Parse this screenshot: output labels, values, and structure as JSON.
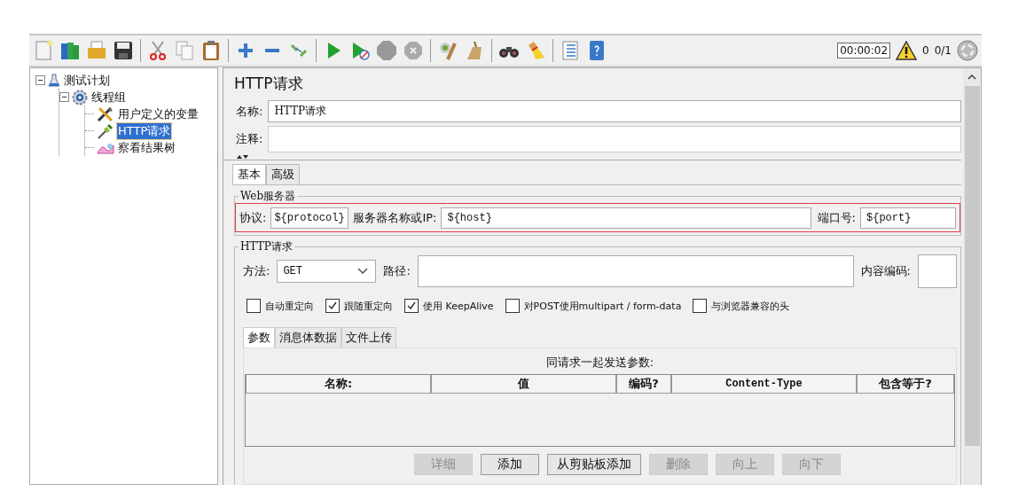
{
  "toolbar": {
    "timer": "00:00:02",
    "warnings": "0",
    "threads": "0/1"
  },
  "tree": [
    {
      "label": "测试计划",
      "kind": "flask",
      "expanded": true,
      "selected": false,
      "children": [
        {
          "label": "线程组",
          "kind": "gear",
          "expanded": true,
          "selected": false,
          "children": [
            {
              "label": "用户定义的变量",
              "kind": "tools",
              "selected": false
            },
            {
              "label": "HTTP请求",
              "kind": "pipette",
              "selected": true
            },
            {
              "label": "察看结果树",
              "kind": "chart",
              "selected": false
            }
          ]
        }
      ]
    }
  ],
  "panel": {
    "title": "HTTP请求",
    "name_label": "名称:",
    "name_value": "HTTP请求",
    "comment_label": "注释:"
  },
  "tabs": [
    {
      "label": "基本",
      "selected": true
    },
    {
      "label": "高级",
      "selected": false
    }
  ],
  "web_server": {
    "legend": "Web服务器",
    "highlighted": true,
    "protocol_label": "协议:",
    "protocol": "${protocol}",
    "host_label": "服务器名称或IP:",
    "host": "${host}",
    "port_label": "端口号:",
    "port": "${port}"
  },
  "http_request": {
    "legend": "HTTP请求",
    "method_label": "方法:",
    "method": "GET",
    "path_label": "路径:",
    "encoding_label": "内容编码:",
    "options": [
      {
        "label": "自动重定向",
        "checked": false
      },
      {
        "label": "跟随重定向",
        "checked": true
      },
      {
        "label": "使用 KeepAlive",
        "checked": true
      },
      {
        "label": "对POST使用multipart / form-data",
        "checked": false
      },
      {
        "label": "与浏览器兼容的头",
        "checked": false
      }
    ]
  },
  "sub_tabs": [
    {
      "label": "参数",
      "selected": true
    },
    {
      "label": "消息体数据",
      "selected": false
    },
    {
      "label": "文件上传",
      "selected": false
    }
  ],
  "params": {
    "caption": "同请求一起发送参数:",
    "columns": [
      "名称:",
      "值",
      "编码?",
      "Content-Type",
      "包含等于?"
    ]
  },
  "buttons": [
    {
      "label": "详细",
      "disabled": true
    },
    {
      "label": "添加",
      "disabled": false
    },
    {
      "label": "从剪贴板添加",
      "disabled": false
    },
    {
      "label": "删除",
      "disabled": true
    },
    {
      "label": "向上",
      "disabled": true
    },
    {
      "label": "向下",
      "disabled": true
    }
  ]
}
